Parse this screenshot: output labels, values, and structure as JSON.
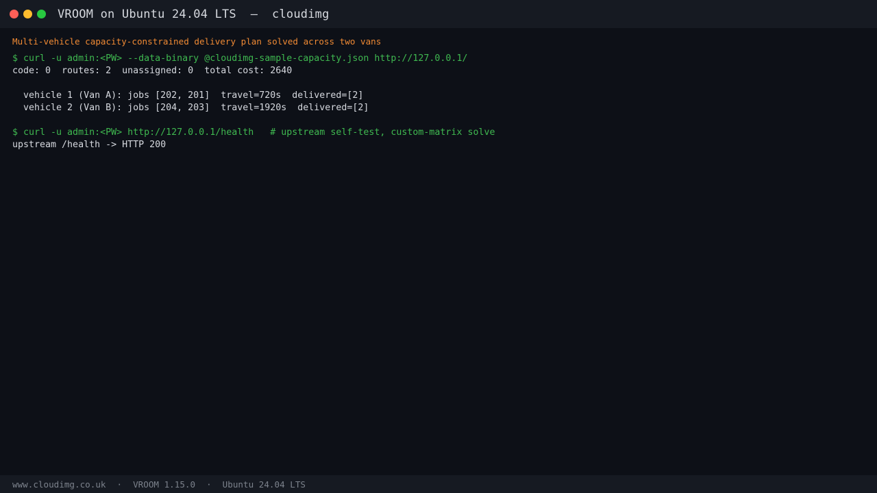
{
  "window": {
    "title": "VROOM on Ubuntu 24.04 LTS  —  cloudimg",
    "colors": {
      "close": "#ff5f57",
      "minimize": "#febc2e",
      "maximize": "#28c840",
      "background": "#0d1017",
      "command": "#3fb950",
      "banner": "#f08a34"
    }
  },
  "terminal": {
    "banner": "Multi-vehicle capacity-constrained delivery plan solved across two vans",
    "lines": [
      "$ curl -u admin:<PW> --data-binary @cloudimg-sample-capacity.json http://127.0.0.1/",
      "code: 0  routes: 2  unassigned: 0  total cost: 2640",
      "",
      "  vehicle 1 (Van A): jobs [202, 201]  travel=720s  delivered=[2]",
      "  vehicle 2 (Van B): jobs [204, 203]  travel=1920s  delivered=[2]",
      "",
      "$ curl -u admin:<PW> http://127.0.0.1/health   # upstream self-test, custom-matrix solve",
      "upstream /health -> HTTP 200"
    ]
  },
  "statusbar": {
    "site": "www.cloudimg.co.uk",
    "separator": "·",
    "version": "VROOM 1.15.0",
    "os": "Ubuntu 24.04 LTS"
  }
}
